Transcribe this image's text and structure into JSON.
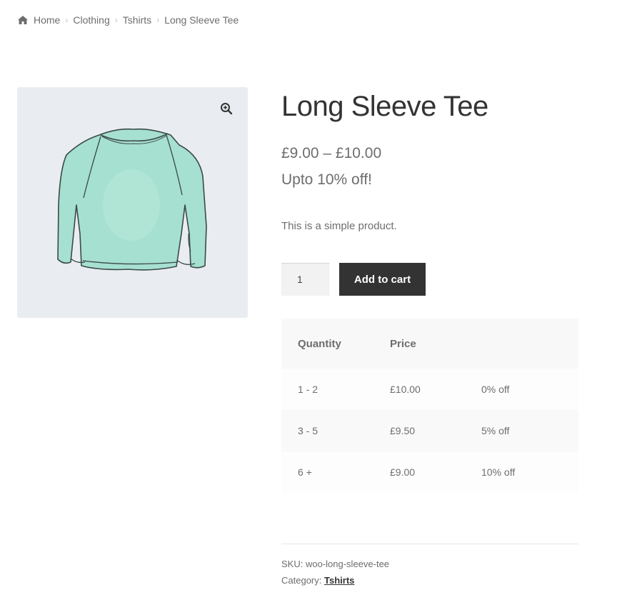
{
  "breadcrumb": {
    "home": "Home",
    "items": [
      "Clothing",
      "Tshirts",
      "Long Sleeve Tee"
    ]
  },
  "product": {
    "title": "Long Sleeve Tee",
    "price": "£9.00 – £10.00",
    "discount_note": "Upto 10% off!",
    "short_description": "This is a simple product.",
    "quantity": "1",
    "add_to_cart_label": "Add to cart",
    "image_icon": "long-sleeve-shirt",
    "zoom_icon": "zoom-in-icon"
  },
  "pricing_table": {
    "headers": [
      "Quantity",
      "Price",
      ""
    ],
    "rows": [
      {
        "qty": "1 - 2",
        "price": "£10.00",
        "discount": "0% off"
      },
      {
        "qty": "3 - 5",
        "price": "£9.50",
        "discount": "5% off"
      },
      {
        "qty": "6 +",
        "price": "£9.00",
        "discount": "10% off"
      }
    ]
  },
  "meta": {
    "sku_label": "SKU:",
    "sku_value": "woo-long-sleeve-tee",
    "category_label": "Category:",
    "category_value": "Tshirts"
  },
  "colors": {
    "button_bg": "#333333",
    "gallery_bg": "#e9edf1",
    "shirt": "#9fdcca"
  }
}
